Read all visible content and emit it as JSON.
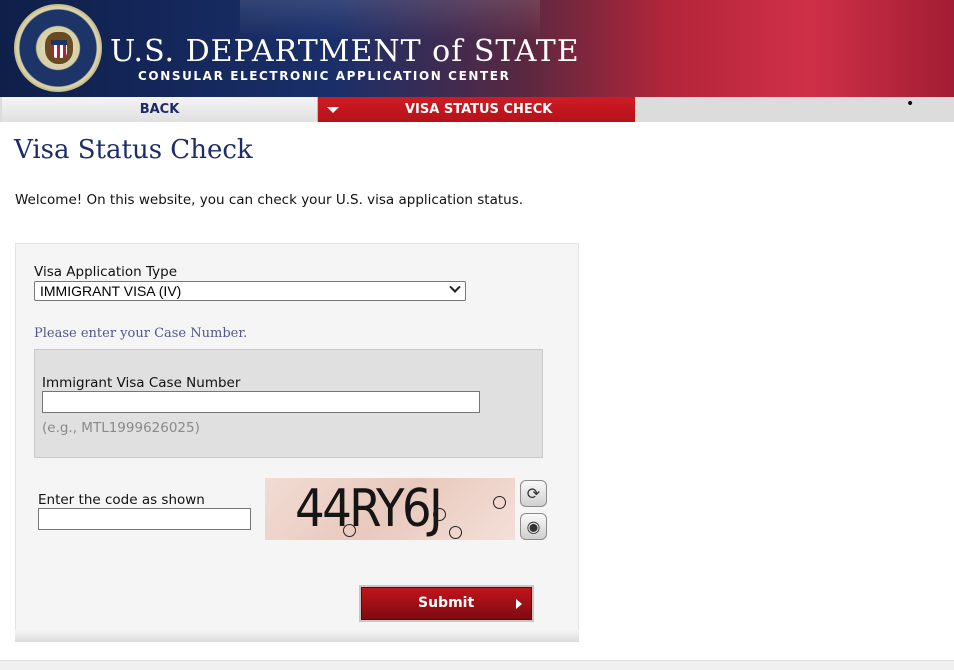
{
  "header": {
    "title": "U.S. DEPARTMENT of STATE",
    "subtitle": "CONSULAR ELECTRONIC APPLICATION CENTER"
  },
  "nav": {
    "back_label": "BACK",
    "active_label": "VISA STATUS CHECK"
  },
  "page": {
    "title": "Visa Status Check",
    "welcome": "Welcome! On this website, you can check your U.S. visa application status."
  },
  "form": {
    "application_type_label": "Visa Application Type",
    "application_type_value": "IMMIGRANT VISA (IV)",
    "case_prompt": "Please enter your Case Number.",
    "case_number_label": "Immigrant Visa Case Number",
    "case_number_value": "",
    "case_number_example": "(e.g., MTL1999626025)",
    "code_label": "Enter the code as shown",
    "code_value": "",
    "captcha_text": "44RY6J",
    "submit_label": "Submit"
  },
  "colors": {
    "nav_active": "#c4141c",
    "title_blue": "#1e2c6a",
    "submit_red": "#9c0f16"
  },
  "icons": {
    "refresh": "refresh-captcha-icon",
    "audio": "audio-captcha-icon",
    "nav_arrow": "triangle-down-icon",
    "submit_arrow": "triangle-right-icon"
  }
}
